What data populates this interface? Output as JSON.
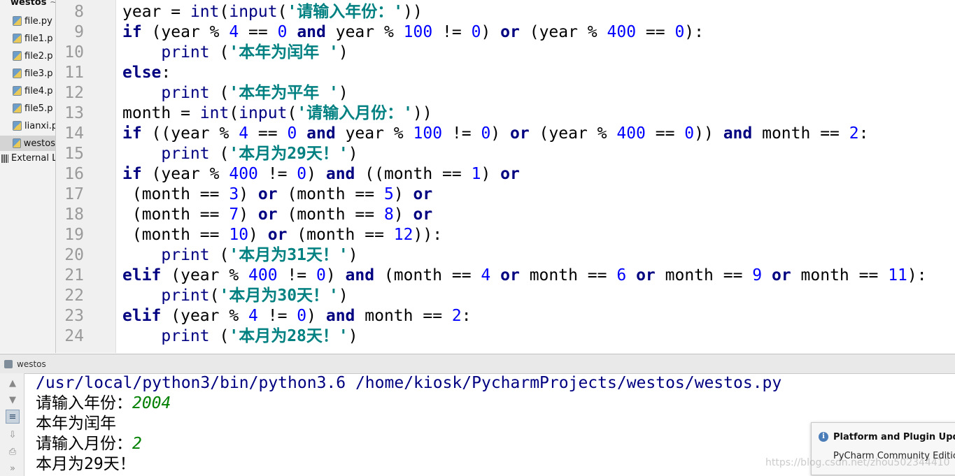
{
  "project_panel": {
    "root": "westos",
    "root_suffix": "~",
    "files": [
      "file.py",
      "file1.p",
      "file2.p",
      "file3.p",
      "file4.p",
      "file5.p",
      "lianxi.p",
      "westos"
    ],
    "selected_index": 7,
    "external": "External L"
  },
  "editor": {
    "line_numbers": [
      "8",
      "9",
      "10",
      "11",
      "12",
      "13",
      "14",
      "15",
      "16",
      "17",
      "18",
      "19",
      "20",
      "21",
      "22",
      "23",
      "24"
    ]
  },
  "run": {
    "title": "westos",
    "console": {
      "command": "/usr/local/python3/bin/python3.6 /home/kiosk/PycharmProjects/westos/westos.py",
      "prompt_year": "请输入年份：",
      "input_year": "2004",
      "out_leap": "本年为闰年",
      "prompt_month": "请输入月份：",
      "input_month": "2",
      "out_days": "本月为29天！"
    }
  },
  "notification": {
    "title": "Platform and Plugin Upda",
    "subtitle": "PyCharm Community Editio"
  },
  "watermark": "https://blog.csdn.net/zhou502344410",
  "colors": {
    "keyword": "#000080",
    "number": "#0000ff",
    "string": "#008080",
    "console_input": "#008000"
  }
}
